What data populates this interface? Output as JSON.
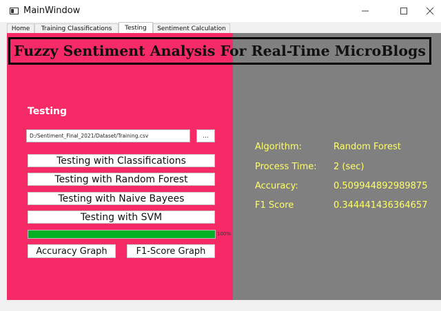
{
  "window": {
    "title": "MainWindow"
  },
  "tabs": [
    {
      "label": "Home"
    },
    {
      "label": "Training Classifications"
    },
    {
      "label": "Testing"
    },
    {
      "label": "Sentiment Calculation"
    }
  ],
  "active_tab": "Testing",
  "banner": {
    "text": "Fuzzy Sentiment Analysis For Real-Time MicroBlogs"
  },
  "left": {
    "section_title": "Testing",
    "file_path": "D:/Sentiment_Final_2021/Dataset/Training.csv",
    "browse_label": "...",
    "buttons": [
      "Testing with Classifications",
      "Testing with Random Forest",
      "Testing with Naive Bayees",
      "Testing with SVM"
    ],
    "progress": {
      "value": 100,
      "label": "100%"
    },
    "graph_buttons": [
      "Accuracy Graph",
      "F1-Score Graph"
    ]
  },
  "results": [
    {
      "label": "Algorithm:",
      "value": "Random Forest"
    },
    {
      "label": "Process Time:",
      "value": "2 (sec)"
    },
    {
      "label": "Accuracy:",
      "value": "0.509944892989875"
    },
    {
      "label": "F1 Score",
      "value": "0.344441436364657"
    }
  ],
  "colors": {
    "left_panel": "#f72a68",
    "right_panel": "#808080",
    "result_text": "#ffff66",
    "progress_fill": "#06b025"
  },
  "icons": [
    "app-window-icon",
    "minimize-icon",
    "maximize-icon",
    "close-icon"
  ]
}
